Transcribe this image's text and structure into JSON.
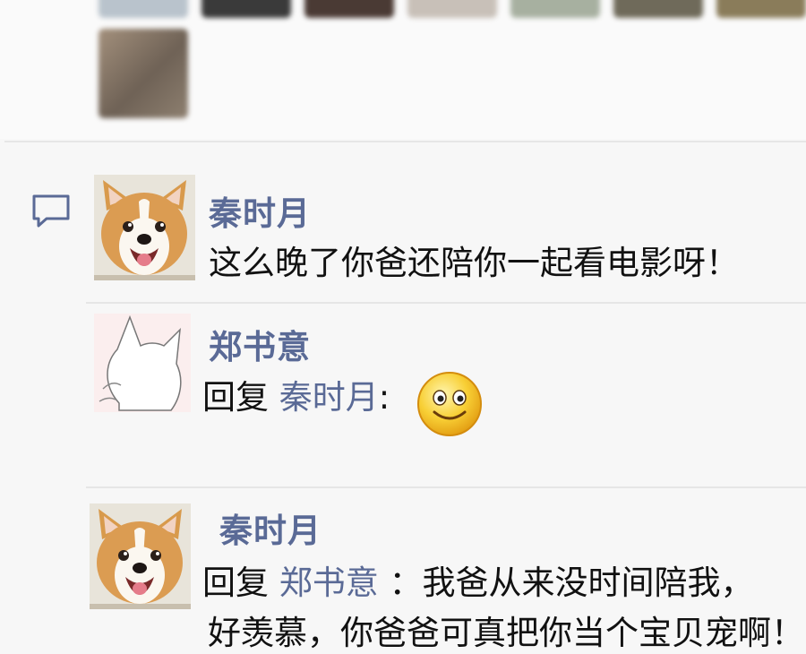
{
  "comments": [
    {
      "author": "秦时月",
      "text": "这么晚了你爸还陪你一起看电影呀！"
    },
    {
      "author": "郑书意",
      "reply_word": "回复",
      "reply_target": "秦时月",
      "colon": ":",
      "emoji": "smiley-emoji"
    },
    {
      "author": "秦时月",
      "reply_word": "回复",
      "reply_target": "郑书意",
      "text": "：我爸从来没时间陪我，",
      "text_line2": "好羡慕，你爸爸可真把你当个宝贝宠啊！"
    }
  ],
  "icons": {
    "comment": "comment-bubble-icon"
  },
  "colors": {
    "name_link": "#5a6a96",
    "text": "#111111",
    "background": "#f7f7f7"
  }
}
